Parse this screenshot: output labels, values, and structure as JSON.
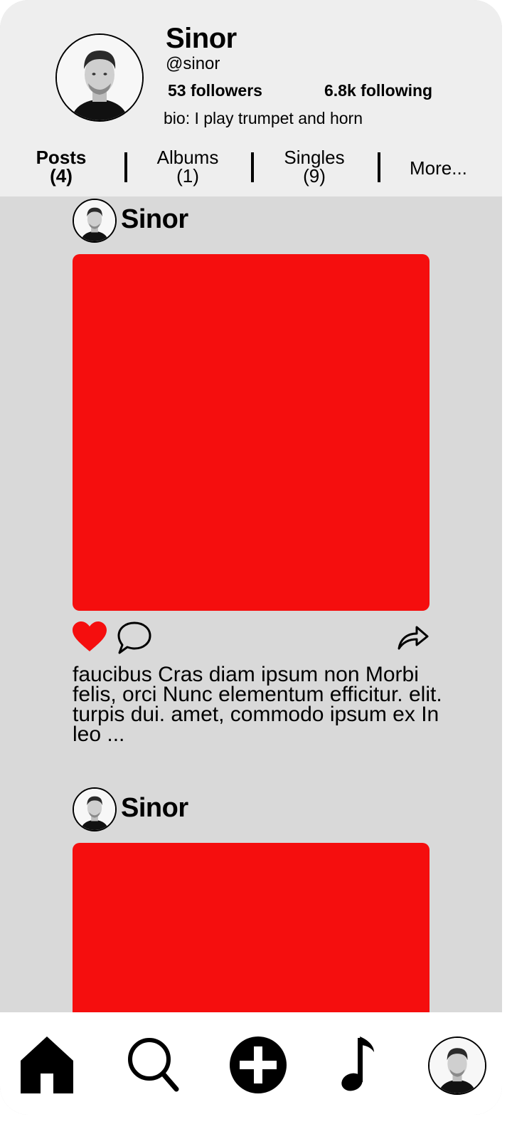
{
  "profile": {
    "name": "Sinor",
    "handle": "@sinor",
    "followers": "53 followers",
    "following": "6.8k following",
    "bio": "bio: I play trumpet and horn"
  },
  "tabs": [
    {
      "label": "Posts",
      "count": "(4)",
      "active": true
    },
    {
      "label": "Albums",
      "count": "(1)",
      "active": false
    },
    {
      "label": "Singles",
      "count": "(9)",
      "active": false
    },
    {
      "label": "More...",
      "active": false
    }
  ],
  "posts": [
    {
      "author": "Sinor",
      "image_color": "#f50e0e",
      "liked": true,
      "caption": "faucibus Cras diam ipsum non Morbi felis, orci Nunc elementum efficitur. elit. turpis dui. amet, commodo ipsum ex In leo ..."
    },
    {
      "author": "Sinor",
      "image_color": "#f50e0e"
    }
  ],
  "nav": {
    "items": [
      "home-icon",
      "search-icon",
      "add-icon",
      "music-note-icon",
      "profile-avatar"
    ]
  },
  "colors": {
    "header_bg": "#eeeeee",
    "feed_bg": "#d9d9d9",
    "accent_red": "#f50e0e",
    "nav_bg": "#ffffff"
  }
}
